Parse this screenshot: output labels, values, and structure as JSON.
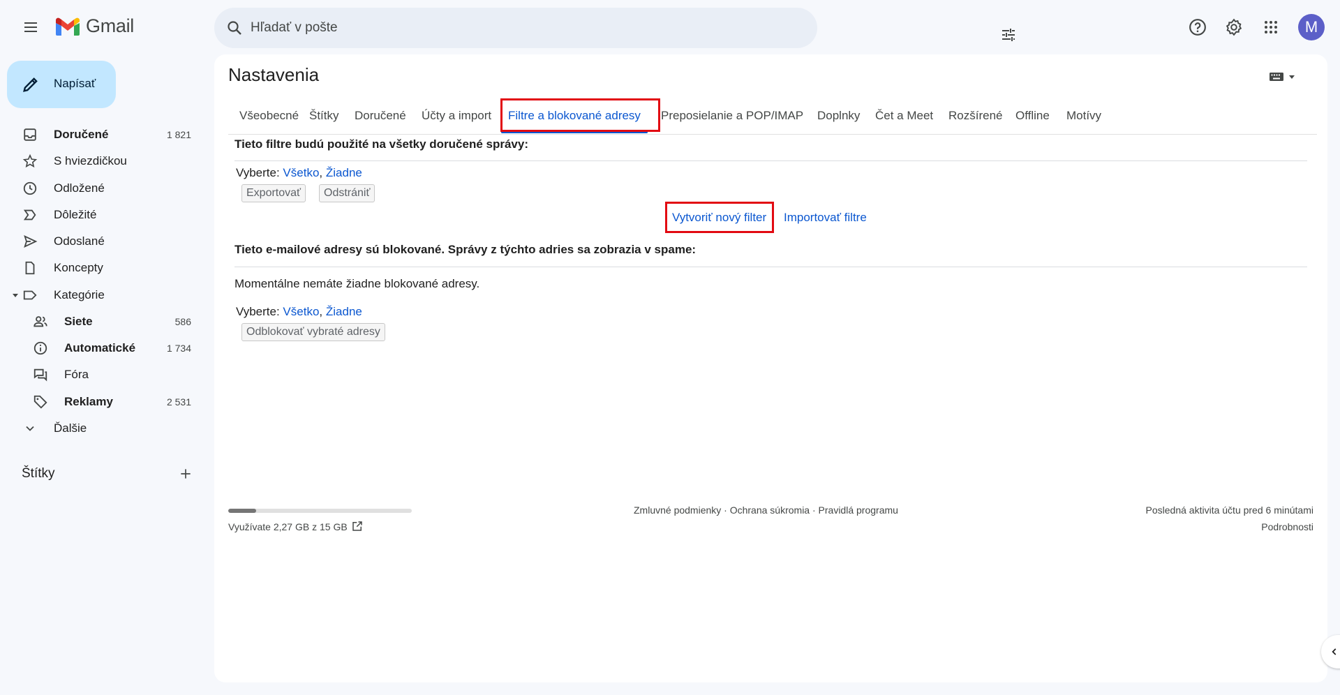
{
  "app": {
    "name": "Gmail"
  },
  "search": {
    "placeholder": "Hľadať v pošte"
  },
  "avatar": {
    "initial": "M",
    "color": "#5c5fc8"
  },
  "compose": {
    "label": "Napísať"
  },
  "nav": {
    "items": [
      {
        "label": "Doručené",
        "count": "1 821",
        "icon": "inbox-icon",
        "bold": true
      },
      {
        "label": "S hviezdičkou",
        "count": "",
        "icon": "star-icon",
        "bold": false
      },
      {
        "label": "Odložené",
        "count": "",
        "icon": "clock-icon",
        "bold": false
      },
      {
        "label": "Dôležité",
        "count": "",
        "icon": "important-icon",
        "bold": false
      },
      {
        "label": "Odoslané",
        "count": "",
        "icon": "send-icon",
        "bold": false
      },
      {
        "label": "Koncepty",
        "count": "",
        "icon": "draft-icon",
        "bold": false
      },
      {
        "label": "Kategórie",
        "count": "",
        "icon": "label-icon",
        "bold": false
      }
    ],
    "categories": [
      {
        "label": "Siete",
        "count": "586",
        "icon": "people-icon",
        "bold": true
      },
      {
        "label": "Automatické",
        "count": "1 734",
        "icon": "info-icon",
        "bold": true
      },
      {
        "label": "Fóra",
        "count": "",
        "icon": "forum-icon",
        "bold": false
      },
      {
        "label": "Reklamy",
        "count": "2 531",
        "icon": "tag-icon",
        "bold": true
      }
    ],
    "more_label": "Ďalšie"
  },
  "labels": {
    "heading": "Štítky"
  },
  "settings": {
    "title": "Nastavenia",
    "tabs": [
      {
        "label": "Všeobecné",
        "active": false
      },
      {
        "label": "Štítky",
        "active": false
      },
      {
        "label": "Doručené",
        "active": false
      },
      {
        "label": "Účty a import",
        "active": false
      },
      {
        "label": "Filtre a blokované adresy",
        "active": true
      },
      {
        "label": "Preposielanie a POP/IMAP",
        "active": false
      },
      {
        "label": "Doplnky",
        "active": false
      },
      {
        "label": "Čet a Meet",
        "active": false
      },
      {
        "label": "Rozšírené",
        "active": false
      },
      {
        "label": "Offline",
        "active": false
      },
      {
        "label": "Motívy",
        "active": false
      }
    ],
    "filters": {
      "heading": "Tieto filtre budú použité na všetky doručené správy:",
      "select_label": "Vyberte:",
      "select_all": "Všetko",
      "separator": ",",
      "select_none": "Žiadne",
      "export_button": "Exportovať",
      "delete_button": "Odstrániť",
      "create_link": "Vytvoriť nový filter",
      "import_link": "Importovať filtre"
    },
    "blocked": {
      "heading": "Tieto e-mailové adresy sú blokované. Správy z týchto adries sa zobrazia v spame:",
      "empty_text": "Momentálne nemáte žiadne blokované adresy.",
      "select_label": "Vyberte:",
      "select_all": "Všetko",
      "separator": ",",
      "select_none": "Žiadne",
      "unblock_button": "Odblokovať vybraté adresy"
    }
  },
  "footer": {
    "storage_text": "Využívate 2,27 GB z 15 GB",
    "storage_fraction": 0.151,
    "links": "Zmluvné podmienky · Ochrana súkromia · Pravidlá programu",
    "activity": "Posledná aktivita účtu pred 6 minútami",
    "details": "Podrobnosti"
  },
  "colors": {
    "accent": "#0b57d0",
    "highlight_box": "#e20a12",
    "compose_bg": "#c2e7ff"
  }
}
